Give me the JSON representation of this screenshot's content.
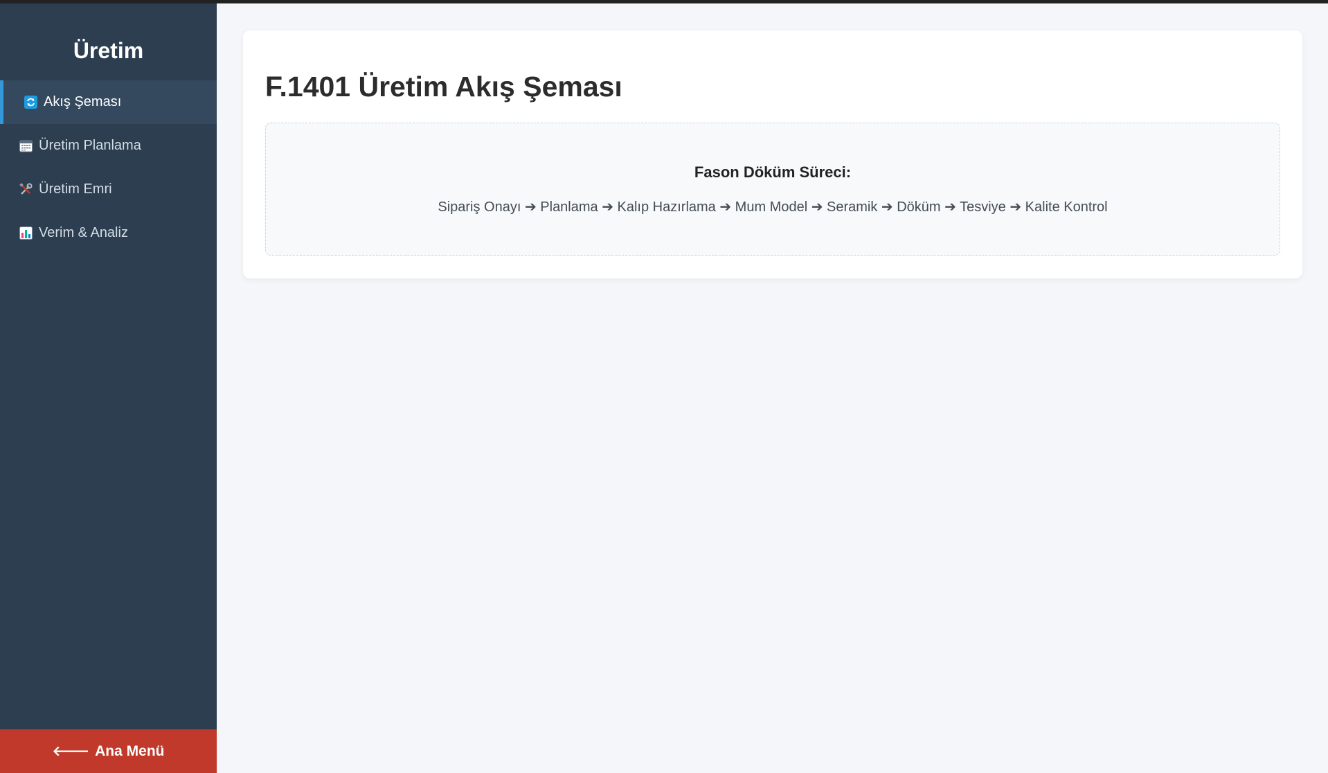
{
  "sidebar": {
    "title": "Üretim",
    "items": [
      {
        "label": "Akış Şeması",
        "icon": "refresh-icon",
        "active": true
      },
      {
        "label": "Üretim Planlama",
        "icon": "calendar-icon",
        "active": false
      },
      {
        "label": "Üretim Emri",
        "icon": "tools-icon",
        "active": false
      },
      {
        "label": "Verim & Analiz",
        "icon": "bar-chart-icon",
        "active": false
      }
    ],
    "home_button": {
      "label": "Ana Menü",
      "icon": "arrow-left-icon"
    }
  },
  "main": {
    "title": "F.1401 Üretim Akış Şeması",
    "flow": {
      "title": "Fason Döküm Süreci:",
      "steps": "Sipariş Onayı ➔ Planlama ➔ Kalıp Hazırlama ➔ Mum Model ➔ Seramik ➔ Döküm ➔ Tesviye ➔ Kalite Kontrol"
    }
  },
  "colors": {
    "sidebar_bg": "#2c3e50",
    "active_item_bg": "#34495e",
    "active_border": "#3498db",
    "home_button_bg": "#c0392b",
    "page_bg": "#f4f6f9"
  }
}
